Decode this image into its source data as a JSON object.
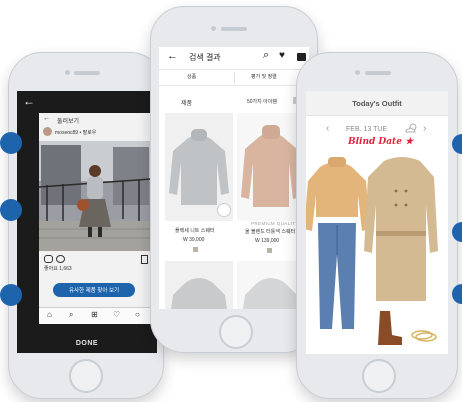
{
  "left_phone": {
    "back_label": "←",
    "header_title": "둘러보기",
    "username": "moseoc89 • 팔로우",
    "likes": "좋아요 1,663",
    "cta_label": "유사한 제품 찾아 보기",
    "done_label": "DONE",
    "accent_color": "#1d64ad"
  },
  "middle_phone": {
    "header_title": "검색 결과",
    "filter_tabs": [
      "상품",
      "평가 및 정렬"
    ],
    "category_label": "제품",
    "result_count": "50가지 아이템",
    "products": [
      {
        "name": "플렉세 니트 스웨터",
        "price": "W 39,000"
      },
      {
        "premium_label": "PREMIUM QUALITY",
        "name": "울 블렌드 터틀넥 스웨터",
        "price": "W 139,000"
      }
    ]
  },
  "right_phone": {
    "title": "Today's Outfit",
    "date": "FEB. 13 TUE",
    "event": "Blind Date",
    "event_color": "#e0233d"
  }
}
